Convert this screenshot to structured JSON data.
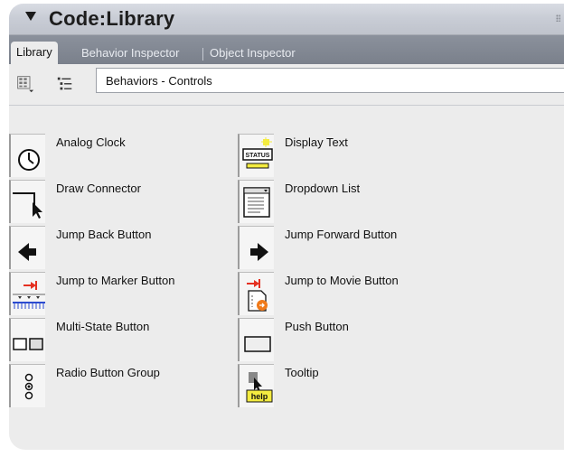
{
  "window": {
    "title": "Code:Library"
  },
  "tabs": [
    {
      "label": "Library",
      "active": true
    },
    {
      "label": "Behavior Inspector",
      "active": false
    },
    {
      "label": "Object Inspector",
      "active": false
    }
  ],
  "toolbar": {
    "category": "Behaviors - Controls"
  },
  "behaviors": [
    {
      "label": "Analog Clock",
      "icon": "analog-clock-icon"
    },
    {
      "label": "Display Text",
      "icon": "display-text-icon"
    },
    {
      "label": "Draw Connector",
      "icon": "draw-connector-icon"
    },
    {
      "label": "Dropdown List",
      "icon": "dropdown-list-icon"
    },
    {
      "label": "Jump Back Button",
      "icon": "jump-back-icon"
    },
    {
      "label": "Jump Forward Button",
      "icon": "jump-forward-icon"
    },
    {
      "label": "Jump to Marker Button",
      "icon": "jump-to-marker-icon"
    },
    {
      "label": "Jump to Movie Button",
      "icon": "jump-to-movie-icon"
    },
    {
      "label": "Multi-State Button",
      "icon": "multi-state-button-icon"
    },
    {
      "label": "Push Button",
      "icon": "push-button-icon"
    },
    {
      "label": "Radio Button Group",
      "icon": "radio-button-group-icon"
    },
    {
      "label": "Tooltip",
      "icon": "tooltip-icon"
    }
  ],
  "icon_text": {
    "display_text_badge": "STATUS",
    "tooltip_badge": "help"
  },
  "colors": {
    "accent_red": "#e53020",
    "accent_orange": "#f07a1a",
    "accent_blue": "#2b4bd0",
    "help_yellow": "#f4ec40"
  }
}
